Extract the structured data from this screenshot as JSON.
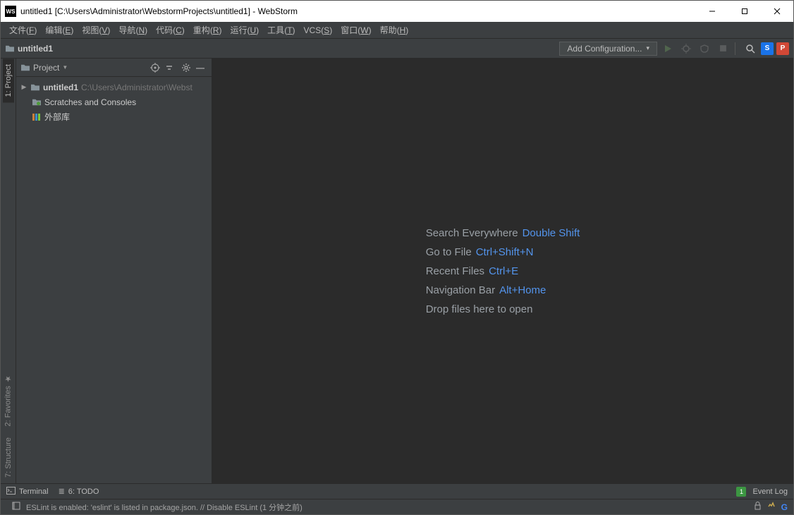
{
  "titlebar": {
    "title": "untitled1 [C:\\Users\\Administrator\\WebstormProjects\\untitled1] - WebStorm"
  },
  "menubar": [
    {
      "label": "文件",
      "ul": "F"
    },
    {
      "label": "编辑",
      "ul": "E"
    },
    {
      "label": "视图",
      "ul": "V"
    },
    {
      "label": "导航",
      "ul": "N"
    },
    {
      "label": "代码",
      "ul": "C"
    },
    {
      "label": "重构",
      "ul": "R"
    },
    {
      "label": "运行",
      "ul": "U"
    },
    {
      "label": "工具",
      "ul": "T"
    },
    {
      "label": "VCS",
      "ul": "S"
    },
    {
      "label": "窗口",
      "ul": "W"
    },
    {
      "label": "帮助",
      "ul": "H"
    }
  ],
  "navbar": {
    "project": "untitled1",
    "add_config": "Add Configuration..."
  },
  "left_tabs": {
    "project": "1: Project",
    "favorites": "2: Favorites",
    "structure": "7: Structure"
  },
  "sidebar": {
    "title": "Project",
    "tree": {
      "root_name": "untitled1",
      "root_path": "C:\\Users\\Administrator\\Webst",
      "scratches": "Scratches and Consoles",
      "external": "外部库"
    }
  },
  "hints": {
    "r1_label": "Search Everywhere",
    "r1_sc": "Double Shift",
    "r2_label": "Go to File",
    "r2_sc": "Ctrl+Shift+N",
    "r3_label": "Recent Files",
    "r3_sc": "Ctrl+E",
    "r4_label": "Navigation Bar",
    "r4_sc": "Alt+Home",
    "r5_label": "Drop files here to open"
  },
  "bottombar": {
    "terminal": "Terminal",
    "todo": "6: TODO",
    "eventlog": "Event Log"
  },
  "statusbar": {
    "msg": "ESLint is enabled: 'eslint' is listed in package.json. // Disable ESLint (1 分钟之前)"
  }
}
